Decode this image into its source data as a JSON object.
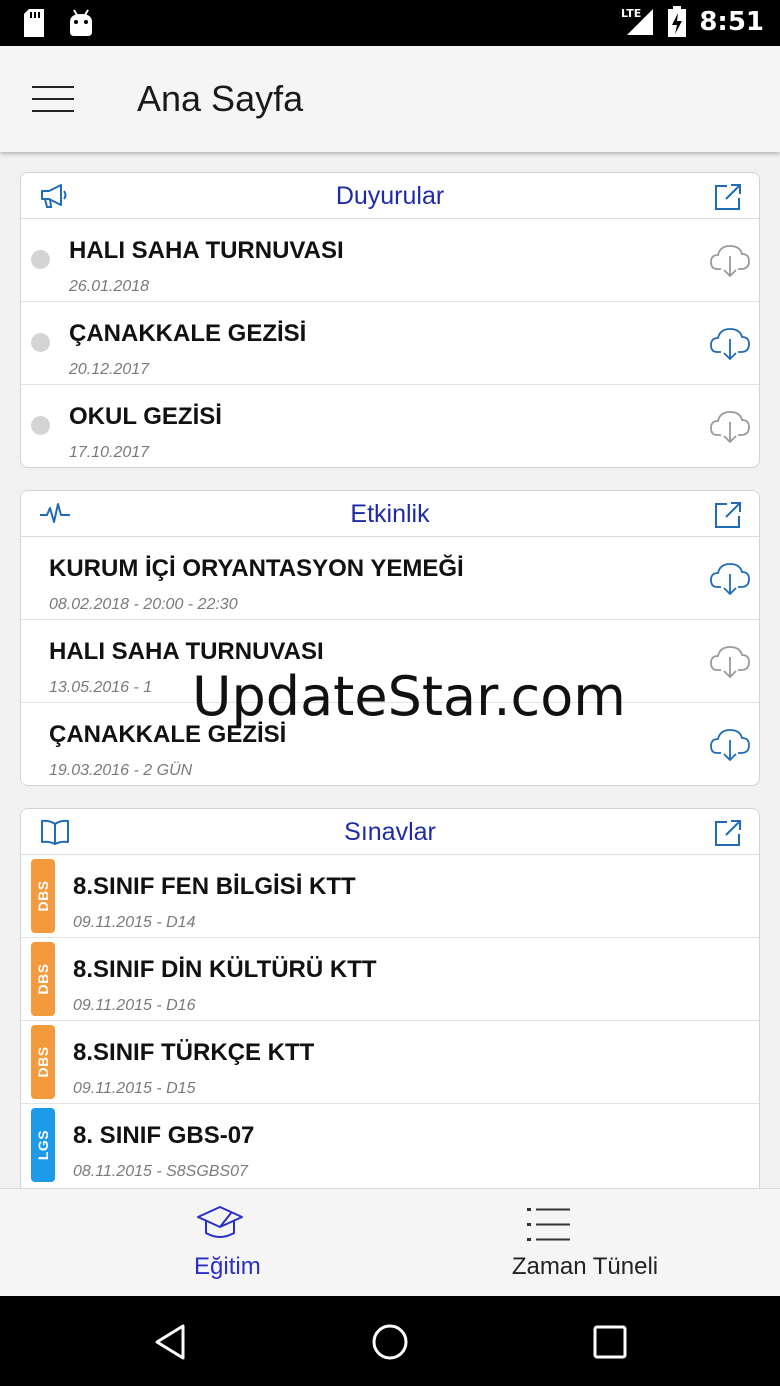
{
  "status_bar": {
    "time": "8:51",
    "network": "LTE"
  },
  "app_bar": {
    "title": "Ana Sayfa"
  },
  "cards": {
    "duyurular": {
      "title": "Duyurular",
      "items": [
        {
          "title": "HALI SAHA TURNUVASI",
          "date": "26.01.2018",
          "cloud_color": "#9a9a9a"
        },
        {
          "title": "ÇANAKKALE GEZİSİ",
          "date": "20.12.2017",
          "cloud_color": "#1f6bb5"
        },
        {
          "title": "OKUL GEZİSİ",
          "date": "17.10.2017",
          "cloud_color": "#9a9a9a"
        }
      ]
    },
    "etkinlik": {
      "title": "Etkinlik",
      "items": [
        {
          "title": "KURUM İÇİ ORYANTASYON YEMEĞİ",
          "date": "08.02.2018 - 20:00 - 22:30",
          "cloud_color": "#1f6bb5"
        },
        {
          "title": "HALI SAHA TURNUVASI",
          "date": "13.05.2016 - 1",
          "cloud_color": "#9a9a9a"
        },
        {
          "title": "ÇANAKKALE GEZİSİ",
          "date": "19.03.2016 - 2 GÜN",
          "cloud_color": "#1f6bb5"
        }
      ]
    },
    "sinavlar": {
      "title": "Sınavlar",
      "items": [
        {
          "badge": "DBS",
          "badge_color": "#f39a3c",
          "title": "8.SINIF FEN BİLGİSİ KTT",
          "date": "09.11.2015 - D14"
        },
        {
          "badge": "DBS",
          "badge_color": "#f39a3c",
          "title": "8.SINIF DİN KÜLTÜRÜ KTT",
          "date": "09.11.2015 - D16"
        },
        {
          "badge": "DBS",
          "badge_color": "#f39a3c",
          "title": "8.SINIF TÜRKÇE KTT",
          "date": "09.11.2015 - D15"
        },
        {
          "badge": "LGS",
          "badge_color": "#1e9be8",
          "title": "8. SINIF GBS-07",
          "date": "08.11.2015 - S8SGBS07"
        }
      ]
    }
  },
  "bottom_nav": {
    "egitim": {
      "label": "Eğitim",
      "active": true,
      "color": "#2a2fc6"
    },
    "zaman_tuneli": {
      "label": "Zaman Tüneli",
      "active": false,
      "color": "#222222"
    }
  },
  "watermark": "UpdateStar.com",
  "colors": {
    "accent": "#1f2aa8",
    "cloud_active": "#1f6bb5",
    "cloud_inactive": "#9a9a9a"
  }
}
